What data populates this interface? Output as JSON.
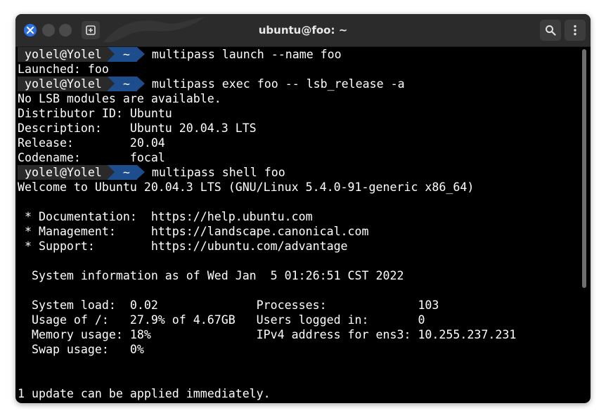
{
  "window": {
    "title": "ubuntu@foo: ~"
  },
  "prompt": {
    "user": "yolel@Yolel",
    "dir": "~"
  },
  "lines": [
    {
      "type": "prompt",
      "text": "multipass launch --name foo"
    },
    {
      "type": "out",
      "text": "Launched: foo"
    },
    {
      "type": "prompt",
      "text": "multipass exec foo -- lsb_release -a"
    },
    {
      "type": "out",
      "text": "No LSB modules are available."
    },
    {
      "type": "out",
      "text": "Distributor ID: Ubuntu"
    },
    {
      "type": "out",
      "text": "Description:    Ubuntu 20.04.3 LTS"
    },
    {
      "type": "out",
      "text": "Release:        20.04"
    },
    {
      "type": "out",
      "text": "Codename:       focal"
    },
    {
      "type": "prompt",
      "text": "multipass shell foo"
    },
    {
      "type": "out",
      "text": "Welcome to Ubuntu 20.04.3 LTS (GNU/Linux 5.4.0-91-generic x86_64)"
    },
    {
      "type": "out",
      "text": ""
    },
    {
      "type": "out",
      "text": " * Documentation:  https://help.ubuntu.com"
    },
    {
      "type": "out",
      "text": " * Management:     https://landscape.canonical.com"
    },
    {
      "type": "out",
      "text": " * Support:        https://ubuntu.com/advantage"
    },
    {
      "type": "out",
      "text": ""
    },
    {
      "type": "out",
      "text": "  System information as of Wed Jan  5 01:26:51 CST 2022"
    },
    {
      "type": "out",
      "text": ""
    },
    {
      "type": "out",
      "text": "  System load:  0.02              Processes:             103"
    },
    {
      "type": "out",
      "text": "  Usage of /:   27.9% of 4.67GB   Users logged in:       0"
    },
    {
      "type": "out",
      "text": "  Memory usage: 18%               IPv4 address for ens3: 10.255.237.231"
    },
    {
      "type": "out",
      "text": "  Swap usage:   0%"
    },
    {
      "type": "out",
      "text": ""
    },
    {
      "type": "out",
      "text": ""
    },
    {
      "type": "out",
      "text": "1 update can be applied immediately."
    }
  ],
  "icons": {
    "close": "close-icon",
    "new_tab": "new-tab-icon",
    "search": "search-icon",
    "menu": "kebab-menu-icon"
  },
  "colors": {
    "accent": "#2e6fe0",
    "prompt_dir_bg": "#1d4d8c",
    "terminal_bg": "#000000",
    "text": "#ffffff"
  }
}
